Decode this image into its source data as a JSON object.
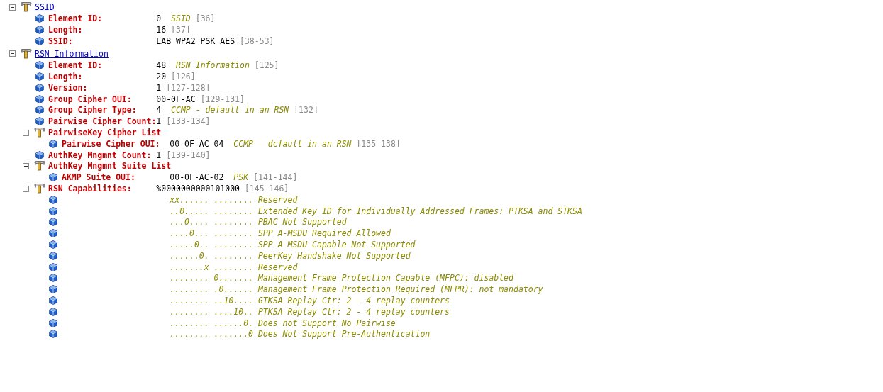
{
  "nodes": [
    {
      "kind": "section",
      "title": "SSID",
      "expanded": true,
      "children": [
        {
          "kind": "field",
          "label": "Element ID:",
          "value": "0",
          "description": "SSID",
          "range": "[36]"
        },
        {
          "kind": "field",
          "label": "Length:",
          "value": "16",
          "range": "[37]"
        },
        {
          "kind": "field",
          "label": "SSID:",
          "value": "LAB WPA2 PSK AES",
          "range": "[38-53]"
        }
      ]
    },
    {
      "kind": "section",
      "title": "RSN Information",
      "expanded": true,
      "children": [
        {
          "kind": "field",
          "label": "Element ID:",
          "value": "48",
          "description": "RSN Information",
          "range": "[125]"
        },
        {
          "kind": "field",
          "label": "Length:",
          "value": "20",
          "range": "[126]"
        },
        {
          "kind": "field",
          "label": "Version:",
          "value": "1",
          "range": "[127-128]"
        },
        {
          "kind": "field",
          "label": "Group Cipher OUI:",
          "value": "00-0F-AC",
          "range": "[129-131]"
        },
        {
          "kind": "field",
          "label": "Group Cipher Type:",
          "value": "4",
          "description": "CCMP - default in an RSN",
          "range": "[132]"
        },
        {
          "kind": "field",
          "label": "Pairwise Cipher Count:",
          "value": "1",
          "range": "[133-134]"
        },
        {
          "kind": "group",
          "title": "PairwiseKey Cipher List",
          "expanded": true,
          "children": [
            {
              "kind": "field",
              "label": "Pairwise Cipher OUI:",
              "value": "00 0F AC 04",
              "description": "CCMP   dcfault in an RSN",
              "range": "[135 138]"
            }
          ]
        },
        {
          "kind": "field",
          "label": "AuthKey Mngmnt Count:",
          "value": "1",
          "range": "[139-140]"
        },
        {
          "kind": "group",
          "title": "AuthKey Mngmnt Suite List",
          "expanded": true,
          "children": [
            {
              "kind": "field",
              "label": "AKMP Suite OUI:",
              "value": "00-0F-AC-02",
              "description": "PSK",
              "range": "[141-144]"
            }
          ]
        },
        {
          "kind": "group",
          "title": "RSN Capabilities:",
          "value": "%0000000000101000",
          "range": "[145-146]",
          "expanded": true,
          "children": [
            {
              "kind": "bits",
              "bits": "xx...... ........",
              "description": "Reserved"
            },
            {
              "kind": "bits",
              "bits": "..0..... ........",
              "description": "Extended Key ID for Individually Addressed Frames: PTKSA and STKSA"
            },
            {
              "kind": "bits",
              "bits": "...0.... ........",
              "description": "PBAC Not Supported"
            },
            {
              "kind": "bits",
              "bits": "....0... ........",
              "description": "SPP A-MSDU Required Allowed"
            },
            {
              "kind": "bits",
              "bits": ".....0.. ........",
              "description": "SPP A-MSDU Capable Not Supported"
            },
            {
              "kind": "bits",
              "bits": "......0. ........",
              "description": "PeerKey Handshake Not Supported"
            },
            {
              "kind": "bits",
              "bits": ".......x ........",
              "description": "Reserved"
            },
            {
              "kind": "bits",
              "bits": "........ 0.......",
              "description": "Management Frame Protection Capable (MFPC): disabled"
            },
            {
              "kind": "bits",
              "bits": "........ .0......",
              "description": "Management Frame Protection Required (MFPR): not mandatory"
            },
            {
              "kind": "bits",
              "bits": "........ ..10....",
              "description": "GTKSA Replay Ctr: 2 - 4 replay counters"
            },
            {
              "kind": "bits",
              "bits": "........ ....10..",
              "description": "PTKSA Replay Ctr: 2 - 4 replay counters"
            },
            {
              "kind": "bits",
              "bits": "........ ......0.",
              "description": "Does not Support No Pairwise"
            },
            {
              "kind": "bits",
              "bits": "........ .......0",
              "description": "Does Not Support Pre-Authentication"
            }
          ]
        }
      ]
    }
  ]
}
